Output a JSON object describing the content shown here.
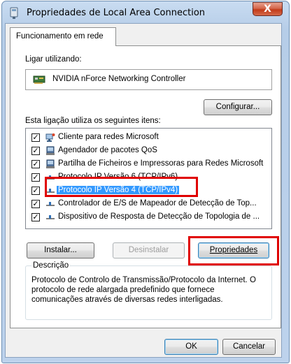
{
  "window": {
    "title": "Propriedades de Local Area Connection",
    "close_label": "X"
  },
  "tabs": [
    {
      "label": "Funcionamento em rede"
    }
  ],
  "connect_using": {
    "label": "Ligar utilizando:",
    "adapter_name": "NVIDIA nForce Networking Controller",
    "configure_label": "Configurar..."
  },
  "items": {
    "label": "Esta ligação utiliza os seguintes itens:",
    "list": [
      {
        "label": "Cliente para redes Microsoft",
        "checked": true,
        "icon": "network-client-icon"
      },
      {
        "label": "Agendador de pacotes QoS",
        "checked": true,
        "icon": "service-icon"
      },
      {
        "label": "Partilha de Ficheiros e Impressoras para Redes Microsoft",
        "checked": true,
        "icon": "service-icon"
      },
      {
        "label": "Protocolo IP Versão 6 (TCP/IPv6)",
        "checked": true,
        "icon": "protocol-icon"
      },
      {
        "label": "Protocolo IP Versão 4 (TCP/IPv4)",
        "checked": true,
        "icon": "protocol-icon",
        "selected": true
      },
      {
        "label": "Controlador de E/S de Mapeador de Detecção de Top...",
        "checked": true,
        "icon": "protocol-icon"
      },
      {
        "label": "Dispositivo de Resposta de Detecção de Topologia de ...",
        "checked": true,
        "icon": "protocol-icon"
      }
    ]
  },
  "buttons": {
    "install": "Instalar...",
    "uninstall": "Desinstalar",
    "properties": "Propriedades",
    "ok": "OK",
    "cancel": "Cancelar"
  },
  "description": {
    "legend": "Descrição",
    "text": "Protocolo de Controlo de Transmissão/Protocolo da Internet. O protocolo de rede alargada predefinido que fornece comunicações através de diversas redes interligadas."
  },
  "colors": {
    "selection": "#3399ff",
    "highlight_box": "#e00000"
  }
}
